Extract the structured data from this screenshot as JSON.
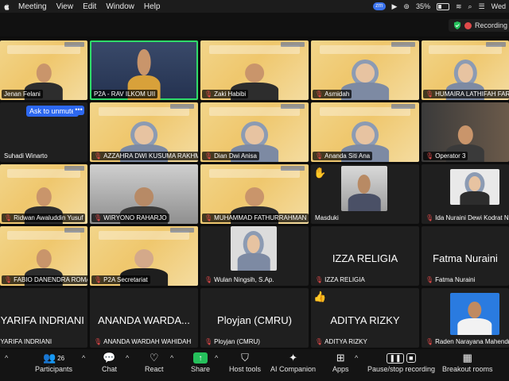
{
  "menubar": {
    "items": [
      "Meeting",
      "View",
      "Edit",
      "Window",
      "Help"
    ],
    "zoom_badge": "zm",
    "battery": "35%",
    "date": "Wed"
  },
  "recording": {
    "label": "Recording"
  },
  "overlay": {
    "unmute_label": "Ask to unmute",
    "more_label": "•••"
  },
  "tiles": [
    {
      "name": "Jenan Felani",
      "muted": false
    },
    {
      "name": "P2A - RAV ILKOM UII",
      "muted": false
    },
    {
      "name": "Zaki Habibi",
      "muted": true
    },
    {
      "name": "Asmidah",
      "muted": true
    },
    {
      "name": "HUMAIRA LATHIFAH FARIDA",
      "muted": true
    },
    {
      "name": "Suhadi Winarto",
      "muted": false
    },
    {
      "name": "AZZAHRA DWI KUSUMA RAKHMA",
      "muted": true
    },
    {
      "name": "Dian Dwi Anisa",
      "muted": true
    },
    {
      "name": "Ananda Siti Ana",
      "muted": true
    },
    {
      "name": "Operator 3",
      "muted": true
    },
    {
      "name": "Ridwan Awaluddin Yusuf",
      "muted": true
    },
    {
      "name": "WIRYONO RAHARJO",
      "muted": true
    },
    {
      "name": "MUHAMMAD FATHURRAHMAN",
      "muted": true
    },
    {
      "name": "Masduki",
      "muted": false
    },
    {
      "name": "Ida Nuraini Dewi Kodrat Ningsih",
      "muted": true
    },
    {
      "name": "FABIO DANENDRA ROMANOV",
      "muted": true
    },
    {
      "name": "P2A Secretariat",
      "muted": true
    },
    {
      "name": "Wulan Ningsih, S.Ap.",
      "muted": true
    },
    {
      "name": "IZZA RELIGIA",
      "muted": true,
      "big": "IZZA RELIGIA"
    },
    {
      "name": "Fatma Nuraini",
      "muted": true,
      "big": "Fatma Nuraini"
    },
    {
      "name": "SYARIFA INDRIANI",
      "muted": false,
      "big": "SYARIFA INDRIANI"
    },
    {
      "name": "ANANDA WARDAH WAHIDAH",
      "muted": true,
      "big": "ANANDA WARDA..."
    },
    {
      "name": "Ployjan (CMRU)",
      "muted": true,
      "big": "Ployjan (CMRU)"
    },
    {
      "name": "ADITYA RIZKY",
      "muted": true,
      "big": "ADITYA RIZKY"
    },
    {
      "name": "Raden Narayana Mahendra",
      "muted": true
    }
  ],
  "toolbar": {
    "participants_label": "Participants",
    "participants_count": "26",
    "chat_label": "Chat",
    "react_label": "React",
    "share_label": "Share",
    "host_tools_label": "Host tools",
    "ai_label": "AI Companion",
    "apps_label": "Apps",
    "recording_label": "Pause/stop recording",
    "breakout_label": "Breakout rooms"
  },
  "colors": {
    "accent": "#2d68f0",
    "share": "#25c05b",
    "mute": "#e84a4a",
    "active_speaker": "#2fdc6a"
  }
}
